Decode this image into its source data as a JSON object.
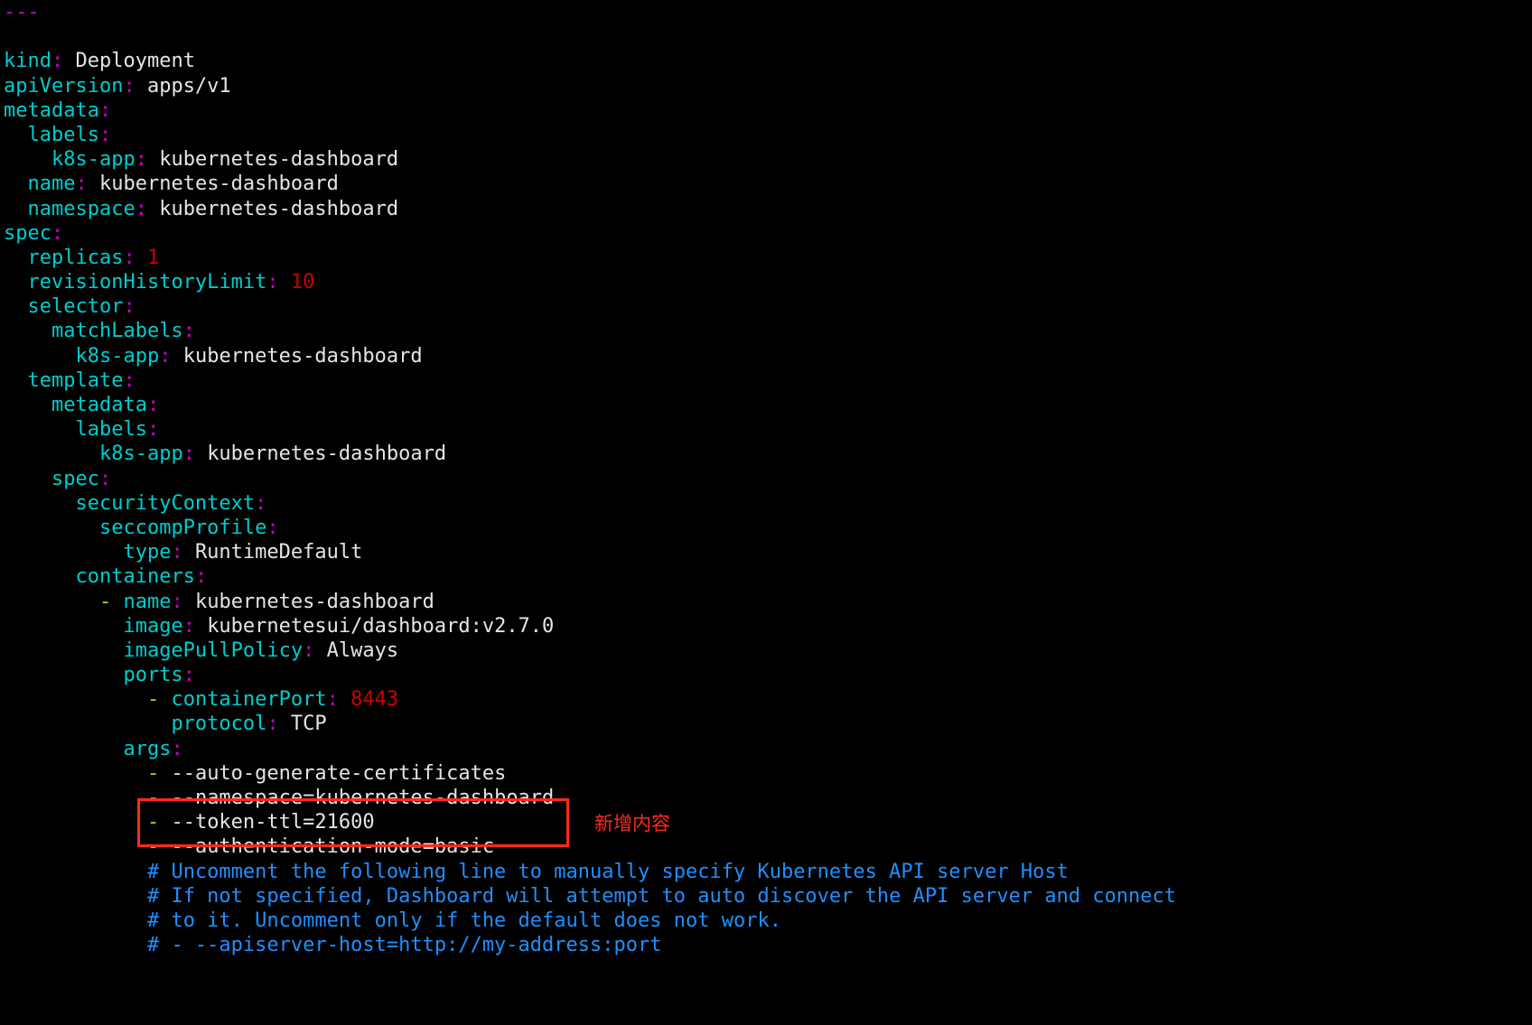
{
  "terminal": {
    "background": "#000000",
    "font_size_px": 22,
    "line_height_px": 27.2
  },
  "theme": {
    "key_color": "#00cdcd",
    "colon_color": "#cd00cd",
    "value_color": "#e5e5e5",
    "number_color": "#cd0000",
    "dash_color": "#cdcd00",
    "comment_color": "#1e90ff",
    "doc_marker_color": "#cd00cd",
    "annotation_color": "#ff2a1a"
  },
  "document": {
    "filename_content_type": "yaml",
    "lines": [
      {
        "indent": 0,
        "type": "doc-start",
        "text": "---"
      },
      {
        "indent": 0,
        "type": "blank",
        "text": ""
      },
      {
        "indent": 0,
        "type": "pair",
        "key": "kind",
        "value": "Deployment"
      },
      {
        "indent": 0,
        "type": "pair",
        "key": "apiVersion",
        "value": "apps/v1"
      },
      {
        "indent": 0,
        "type": "map",
        "key": "metadata"
      },
      {
        "indent": 2,
        "type": "map",
        "key": "labels"
      },
      {
        "indent": 4,
        "type": "pair",
        "key": "k8s-app",
        "value": "kubernetes-dashboard"
      },
      {
        "indent": 2,
        "type": "pair",
        "key": "name",
        "value": "kubernetes-dashboard"
      },
      {
        "indent": 2,
        "type": "pair",
        "key": "namespace",
        "value": "kubernetes-dashboard"
      },
      {
        "indent": 0,
        "type": "map",
        "key": "spec"
      },
      {
        "indent": 2,
        "type": "pair-num",
        "key": "replicas",
        "value": "1"
      },
      {
        "indent": 2,
        "type": "pair-num",
        "key": "revisionHistoryLimit",
        "value": "10"
      },
      {
        "indent": 2,
        "type": "map",
        "key": "selector"
      },
      {
        "indent": 4,
        "type": "map",
        "key": "matchLabels"
      },
      {
        "indent": 6,
        "type": "pair",
        "key": "k8s-app",
        "value": "kubernetes-dashboard"
      },
      {
        "indent": 2,
        "type": "map",
        "key": "template"
      },
      {
        "indent": 4,
        "type": "map",
        "key": "metadata"
      },
      {
        "indent": 6,
        "type": "map",
        "key": "labels"
      },
      {
        "indent": 8,
        "type": "pair",
        "key": "k8s-app",
        "value": "kubernetes-dashboard"
      },
      {
        "indent": 4,
        "type": "map",
        "key": "spec"
      },
      {
        "indent": 6,
        "type": "map",
        "key": "securityContext"
      },
      {
        "indent": 8,
        "type": "map",
        "key": "seccompProfile"
      },
      {
        "indent": 10,
        "type": "pair",
        "key": "type",
        "value": "RuntimeDefault"
      },
      {
        "indent": 6,
        "type": "map",
        "key": "containers"
      },
      {
        "indent": 8,
        "type": "item-pair",
        "key": "name",
        "value": "kubernetes-dashboard"
      },
      {
        "indent": 10,
        "type": "pair",
        "key": "image",
        "value": "kubernetesui/dashboard:v2.7.0"
      },
      {
        "indent": 10,
        "type": "pair",
        "key": "imagePullPolicy",
        "value": "Always"
      },
      {
        "indent": 10,
        "type": "map",
        "key": "ports"
      },
      {
        "indent": 12,
        "type": "item-pair-num",
        "key": "containerPort",
        "value": "8443"
      },
      {
        "indent": 14,
        "type": "pair",
        "key": "protocol",
        "value": "TCP"
      },
      {
        "indent": 10,
        "type": "map",
        "key": "args"
      },
      {
        "indent": 12,
        "type": "item",
        "value": "--auto-generate-certificates"
      },
      {
        "indent": 12,
        "type": "item",
        "value": "--namespace=kubernetes-dashboard"
      },
      {
        "indent": 12,
        "type": "item",
        "value": "--token-ttl=21600",
        "highlighted": true
      },
      {
        "indent": 12,
        "type": "item",
        "value": "--authentication-mode=basic",
        "highlighted": true
      },
      {
        "indent": 12,
        "type": "comment",
        "text": "# Uncomment the following line to manually specify Kubernetes API server Host"
      },
      {
        "indent": 12,
        "type": "comment",
        "text": "# If not specified, Dashboard will attempt to auto discover the API server and connect"
      },
      {
        "indent": 12,
        "type": "comment",
        "text": "# to it. Uncomment only if the default does not work."
      },
      {
        "indent": 12,
        "type": "comment",
        "text": "# - --apiserver-host=http://my-address:port"
      }
    ]
  },
  "annotation": {
    "label": "新增内容",
    "color": "#ff2a1a",
    "highlight_box": {
      "lines": [
        "- --token-ttl=21600",
        "- --authentication-mode=basic"
      ],
      "border_color": "#ff2a1a"
    }
  }
}
